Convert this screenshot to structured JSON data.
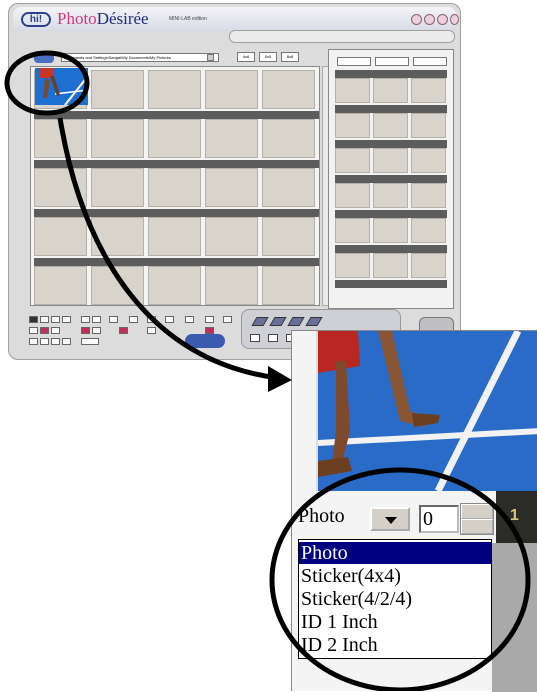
{
  "app": {
    "logo_mark": "hi!",
    "brand_photo": "Photo",
    "brand_desiree": "Désirée",
    "edition": "MINI-LAB edition",
    "path": "Documents and Settings\\Sangal\\My Documents\\My Pictures",
    "layout_options": [
      "4x6",
      "5x5",
      "8x8"
    ]
  },
  "inset": {
    "type_select_value": "Photo",
    "quantity_value": "0",
    "partial_label": "1",
    "dropdown_options": [
      "Photo",
      "Sticker(4x4)",
      "Sticker(4/2/4)",
      "ID 1 Inch",
      "ID 2 Inch"
    ],
    "selected_option": "Photo"
  },
  "colors": {
    "selection_bg": "#000080",
    "callout": "#000000",
    "brand_blue": "#1d2d7a",
    "brand_pink": "#d23a7a"
  }
}
